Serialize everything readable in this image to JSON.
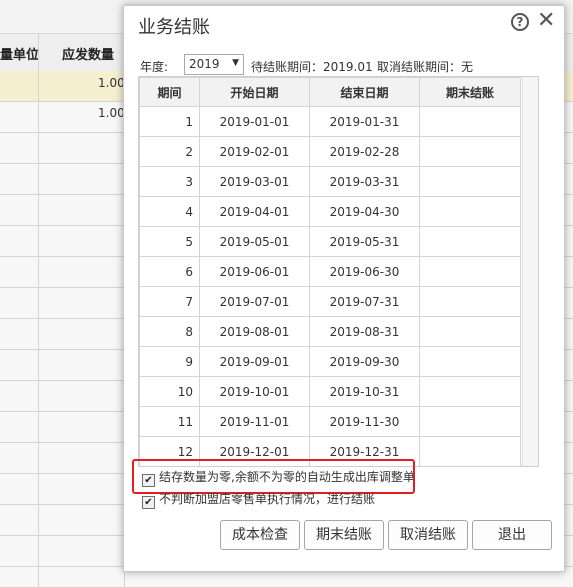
{
  "background": {
    "col_headers": [
      "量单位",
      "应发数量"
    ],
    "row_values": [
      "1.00",
      "1.00"
    ]
  },
  "dialog": {
    "title": "业务结账",
    "year_label": "年度:",
    "year_value": "2019",
    "pending_period": "待结账期间：2019.01",
    "cancel_period": "取消结账期间：无",
    "columns": [
      "期间",
      "开始日期",
      "结束日期",
      "期末结账"
    ],
    "rows": [
      {
        "period": "1",
        "start": "2019-01-01",
        "end": "2019-01-31",
        "closed": ""
      },
      {
        "period": "2",
        "start": "2019-02-01",
        "end": "2019-02-28",
        "closed": ""
      },
      {
        "period": "3",
        "start": "2019-03-01",
        "end": "2019-03-31",
        "closed": ""
      },
      {
        "period": "4",
        "start": "2019-04-01",
        "end": "2019-04-30",
        "closed": ""
      },
      {
        "period": "5",
        "start": "2019-05-01",
        "end": "2019-05-31",
        "closed": ""
      },
      {
        "period": "6",
        "start": "2019-06-01",
        "end": "2019-06-30",
        "closed": ""
      },
      {
        "period": "7",
        "start": "2019-07-01",
        "end": "2019-07-31",
        "closed": ""
      },
      {
        "period": "8",
        "start": "2019-08-01",
        "end": "2019-08-31",
        "closed": ""
      },
      {
        "period": "9",
        "start": "2019-09-01",
        "end": "2019-09-30",
        "closed": ""
      },
      {
        "period": "10",
        "start": "2019-10-01",
        "end": "2019-10-31",
        "closed": ""
      },
      {
        "period": "11",
        "start": "2019-11-01",
        "end": "2019-11-30",
        "closed": ""
      },
      {
        "period": "12",
        "start": "2019-12-01",
        "end": "2019-12-31",
        "closed": ""
      }
    ],
    "option1_label": "结存数量为零,余额不为零的自动生成出库调整单",
    "option1_checked": true,
    "option2_label": "不判断加盟店零售单执行情况，进行结账",
    "option2_checked": true,
    "buttons": {
      "cost_check": "成本检查",
      "period_close": "期末结账",
      "cancel_close": "取消结账",
      "exit": "退出"
    }
  }
}
